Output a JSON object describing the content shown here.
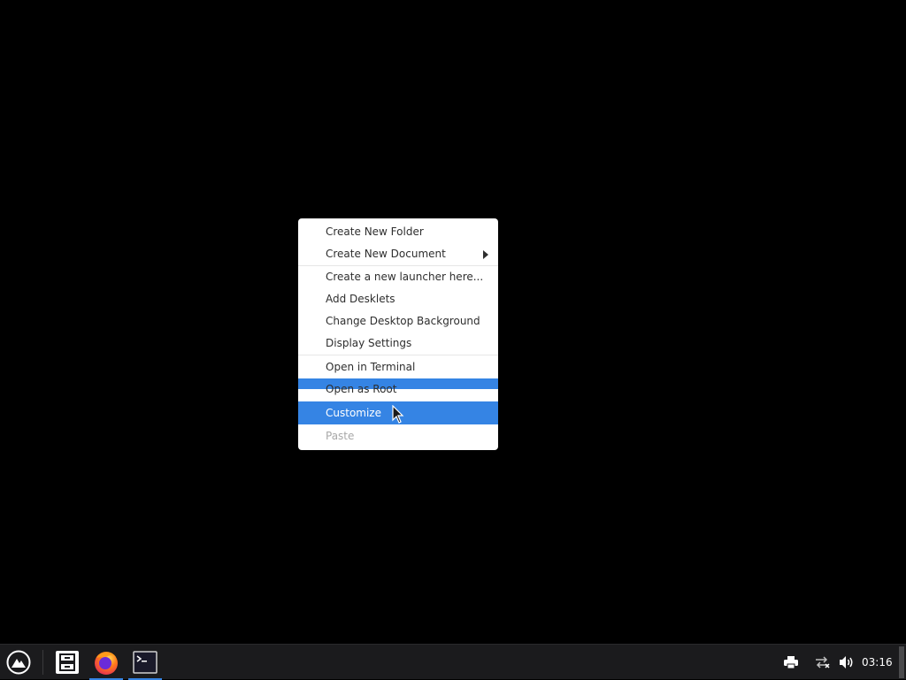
{
  "context_menu": {
    "items": [
      {
        "label": "Create New Folder"
      },
      {
        "label": "Create New Document",
        "has_submenu": true
      },
      {
        "label": "Create a new launcher here..."
      },
      {
        "label": "Add Desklets"
      },
      {
        "label": "Change Desktop Background"
      },
      {
        "label": "Display Settings"
      },
      {
        "label": "Open in Terminal"
      },
      {
        "label": "Open as Root"
      },
      {
        "label": "Customize"
      },
      {
        "label": "Paste",
        "disabled": true
      }
    ],
    "highlight_color": "#3584e4"
  },
  "taskbar": {
    "launchers": [
      {
        "icon": "start-menu-icon"
      },
      {
        "icon": "file-manager-icon"
      },
      {
        "icon": "firefox-icon"
      },
      {
        "icon": "terminal-icon"
      }
    ],
    "tray": {
      "icons": [
        "printer-icon",
        "network-icon",
        "volume-icon"
      ],
      "clock": "03:16"
    },
    "accent_color": "#3584e4"
  }
}
